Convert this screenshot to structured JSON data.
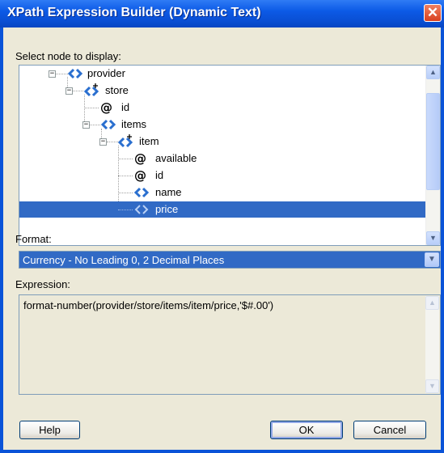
{
  "window": {
    "title": "XPath Expression Builder (Dynamic Text)",
    "close_glyph": "✕"
  },
  "tree": {
    "label": "Select node to display:",
    "nodes": [
      {
        "name": "provider",
        "icon": "element-icon"
      },
      {
        "name": "store",
        "icon": "element-repeating-icon"
      },
      {
        "name": "id",
        "icon": "attribute-icon"
      },
      {
        "name": "items",
        "icon": "element-icon"
      },
      {
        "name": "item",
        "icon": "element-repeating-icon"
      },
      {
        "name": "available",
        "icon": "attribute-icon"
      },
      {
        "name": "id",
        "icon": "attribute-icon"
      },
      {
        "name": "name",
        "icon": "element-icon"
      },
      {
        "name": "price",
        "icon": "element-icon",
        "selected": true
      }
    ],
    "expander_glyph": "−",
    "attribute_glyph": "@"
  },
  "format": {
    "label": "Format:",
    "selected": "Currency - No Leading 0, 2 Decimal Places"
  },
  "expression": {
    "label": "Expression:",
    "value": "format-number(provider/store/items/item/price,'$#.00')"
  },
  "buttons": {
    "help": "Help",
    "ok": "OK",
    "cancel": "Cancel"
  },
  "colors": {
    "titlebar": "#0a4fd4",
    "selection": "#316ac5",
    "dialog_bg": "#ece9d8"
  }
}
